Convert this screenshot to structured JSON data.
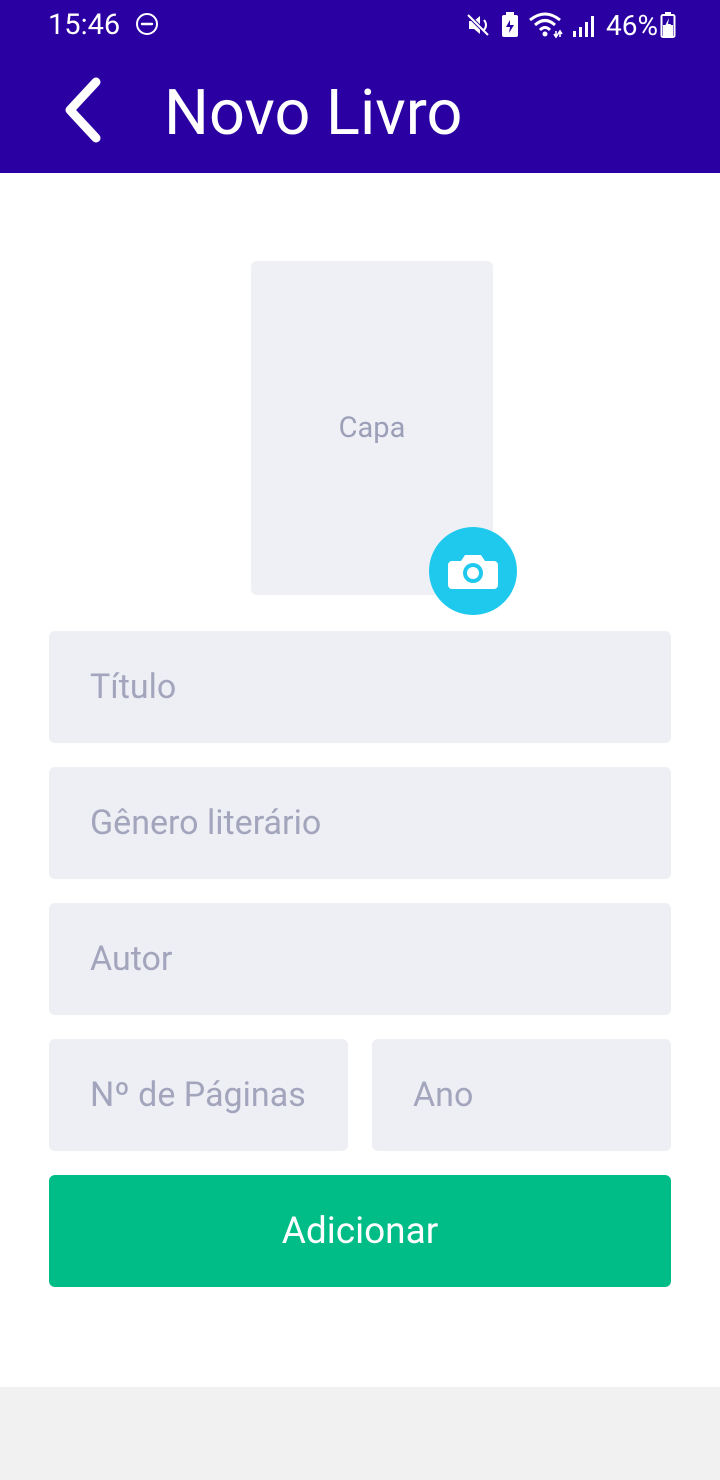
{
  "status_bar": {
    "time": "15:46",
    "battery": "46%",
    "icons": [
      "do-not-disturb-icon",
      "mute-icon",
      "battery-saver-icon",
      "wifi-icon",
      "signal-icon",
      "battery-icon"
    ]
  },
  "header": {
    "title": "Novo Livro",
    "back_icon": "chevron-left-icon",
    "background": "#2b00a3"
  },
  "cover": {
    "label": "Capa",
    "camera_icon": "camera-icon",
    "camera_color": "#1fc9ee"
  },
  "form": {
    "title_placeholder": "Título",
    "genre_placeholder": "Gênero literário",
    "author_placeholder": "Autor",
    "pages_placeholder": "Nº de Páginas",
    "year_placeholder": "Ano"
  },
  "actions": {
    "add_label": "Adicionar",
    "add_color": "#00bc87"
  }
}
